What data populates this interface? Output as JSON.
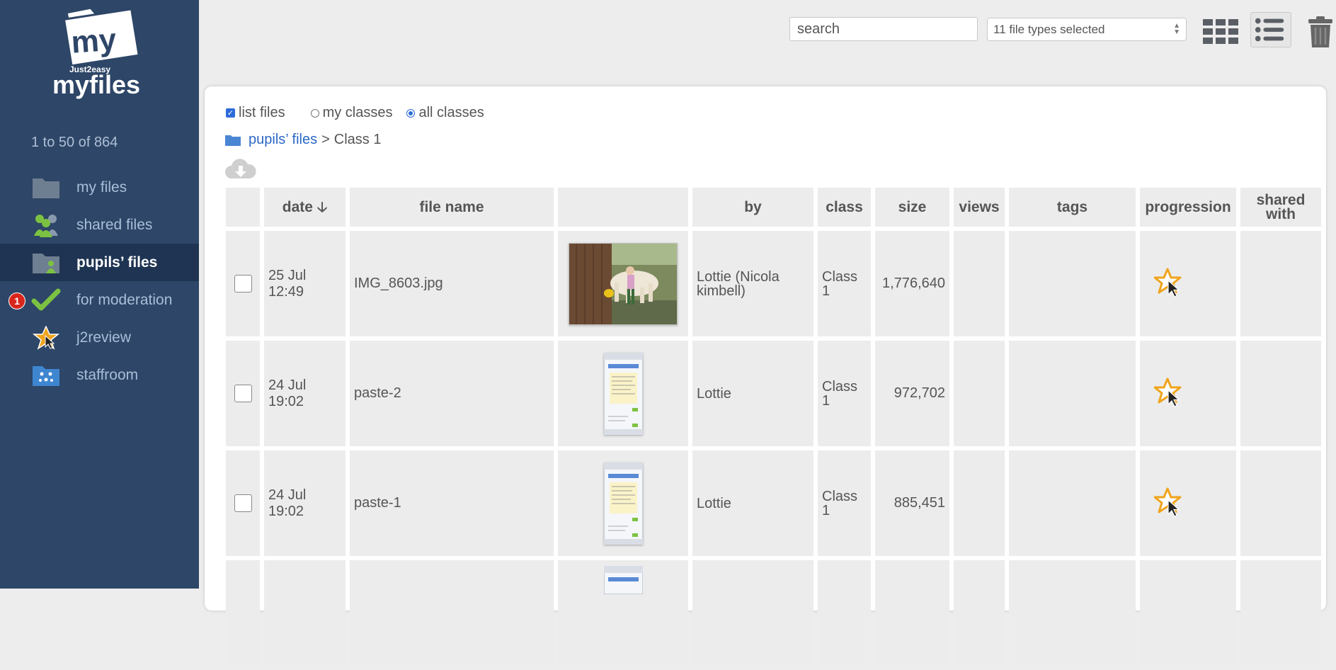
{
  "brand": {
    "logo_top": "my",
    "logo_small": "Just2easy",
    "logo_main": "myfiles"
  },
  "sidebar": {
    "count_text": "1 to 50 of 864",
    "items": [
      {
        "label": "my files",
        "icon": "folder-icon",
        "active": false
      },
      {
        "label": "shared files",
        "icon": "people-icon",
        "active": false
      },
      {
        "label": "pupils’ files",
        "icon": "pupils-folder-icon",
        "active": true
      },
      {
        "label": "for moderation",
        "icon": "checkmark-icon",
        "badge": "1",
        "active": false
      },
      {
        "label": "j2review",
        "icon": "star-cursor-icon",
        "active": false
      },
      {
        "label": "staffroom",
        "icon": "staffroom-icon",
        "active": false
      }
    ]
  },
  "toolbar": {
    "search_placeholder": "search",
    "filetypes_label": "11 file types selected",
    "grid_view_icon": "grid-view-icon",
    "list_view_icon": "list-view-icon",
    "trash_icon": "trash-icon"
  },
  "options": {
    "list_files": "list files",
    "my_classes": "my classes",
    "all_classes": "all classes"
  },
  "breadcrumb": {
    "root": "pupils’ files",
    "sep": ">",
    "current": "Class 1"
  },
  "table": {
    "headers": {
      "date": "date",
      "date_sort": "🡣",
      "file_name": "file name",
      "thumb": "",
      "by": "by",
      "class": "class",
      "size": "size",
      "views": "views",
      "tags": "tags",
      "progression": "progression",
      "shared_1": "shared",
      "shared_2": "with"
    },
    "rows": [
      {
        "date_1": "25 Jul",
        "date_2": "12:49",
        "file_name": "IMG_8603.jpg",
        "thumb": "photo",
        "by_1": "Lottie (Nicola",
        "by_2": "kimbell)",
        "class_1": "Class",
        "class_2": "1",
        "size": "1,776,640",
        "views": "",
        "tags": "",
        "shared": ""
      },
      {
        "date_1": "24 Jul",
        "date_2": "19:02",
        "file_name": "paste-2",
        "thumb": "phone",
        "by_1": "Lottie",
        "by_2": "",
        "class_1": "Class",
        "class_2": "1",
        "size": "972,702",
        "views": "",
        "tags": "",
        "shared": ""
      },
      {
        "date_1": "24 Jul",
        "date_2": "19:02",
        "file_name": "paste-1",
        "thumb": "phone",
        "by_1": "Lottie",
        "by_2": "",
        "class_1": "Class",
        "class_2": "1",
        "size": "885,451",
        "views": "",
        "tags": "",
        "shared": ""
      }
    ]
  },
  "colors": {
    "sidebar": "#2e4667",
    "active": "#1f3452",
    "link": "#2b67c4",
    "star": "#f0a41c",
    "badge": "#d9261c"
  }
}
